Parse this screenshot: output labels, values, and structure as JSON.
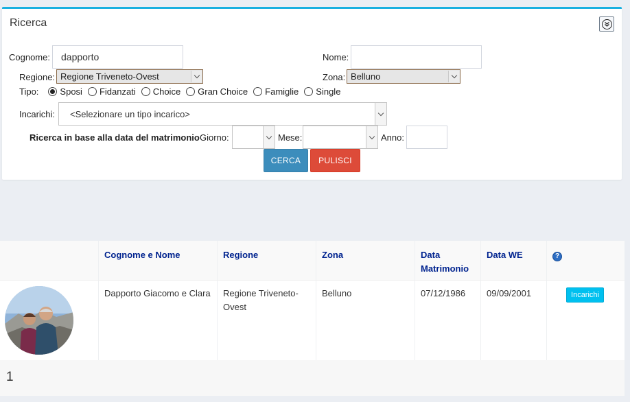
{
  "panel": {
    "title": "Ricerca"
  },
  "form": {
    "cognome_label": "Cognome:",
    "cognome_value": "dapporto",
    "nome_label": "Nome:",
    "nome_value": "",
    "regione_label": "Regione:",
    "regione_value": "Regione Triveneto-Ovest",
    "zona_label": "Zona:",
    "zona_value": "Belluno",
    "tipo_label": "Tipo:",
    "tipo_options": [
      {
        "label": "Sposi",
        "checked": true
      },
      {
        "label": "Fidanzati",
        "checked": false
      },
      {
        "label": "Choice",
        "checked": false
      },
      {
        "label": "Gran Choice",
        "checked": false
      },
      {
        "label": "Famiglie",
        "checked": false
      },
      {
        "label": "Single",
        "checked": false
      }
    ],
    "incarichi_label": "Incarichi:",
    "incarichi_value": "<Selezionare un tipo incarico>",
    "data_label": "Ricerca in base alla data del matrimonio",
    "giorno_label": "Giorno:",
    "mese_label": "Mese:",
    "anno_label": "Anno:",
    "cerca_label": "CERCA",
    "pulisci_label": "PULISCI"
  },
  "table": {
    "headers": {
      "nome": "Cognome e Nome",
      "regione": "Regione",
      "zona": "Zona",
      "data_matrimonio": "Data Matrimonio",
      "data_we": "Data WE"
    },
    "rows": [
      {
        "nome": "Dapporto Giacomo e Clara",
        "regione": "Regione Triveneto-Ovest",
        "zona": "Belluno",
        "data_matrimonio": "07/12/1986",
        "data_we": "09/09/2001",
        "action_label": "Incarichi"
      }
    ]
  },
  "pagination": {
    "current_page": "1"
  },
  "colors": {
    "accent_top": "#1ab0e0",
    "cerca": "#3c8dbc",
    "pulisci": "#dd4b39",
    "incarichi": "#00c0ef",
    "header_text": "#00238f"
  }
}
